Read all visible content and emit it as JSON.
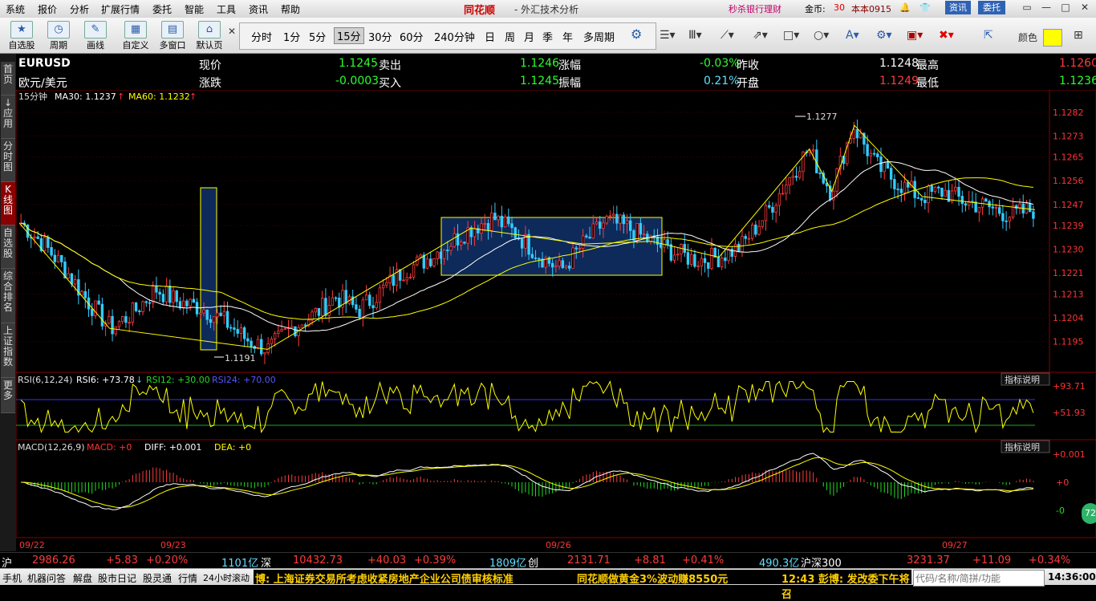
{
  "app": {
    "brand": "同花顺",
    "subtitle": "- 外汇技术分析"
  },
  "menu": [
    "系统",
    "报价",
    "分析",
    "扩展行情",
    "委托",
    "智能",
    "工具",
    "资讯",
    "帮助"
  ],
  "topright": {
    "promo": "秒杀银行理财",
    "coins_label": "金币:",
    "coins_value": "30",
    "user": "本本0915",
    "news_btn": "资讯",
    "trade_btn": "委托"
  },
  "toolbar": {
    "buttons": [
      "自选股",
      "周期",
      "画线",
      "自定义",
      "多窗口",
      "默认页"
    ],
    "periods": [
      "分时",
      "1分",
      "5分",
      "15分",
      "30分",
      "60分",
      "240分钟",
      "日",
      "周",
      "月",
      "季",
      "年",
      "多周期"
    ],
    "active_period": "15分",
    "color_label": "颜色",
    "highlight_color": "#ffff00"
  },
  "sidebar": [
    "首页",
    "应用",
    "分时图",
    "K线图",
    "自选股",
    "综合排名",
    "上证指数",
    "更多"
  ],
  "sidebar_active": "K线图",
  "quote": {
    "symbol": "EURUSD",
    "name": "欧元/美元",
    "fields": [
      {
        "label": "现价",
        "value": "1.1245",
        "color": "green"
      },
      {
        "label": "卖出",
        "value": "1.1246",
        "color": "green"
      },
      {
        "label": "涨幅",
        "value": "-0.03%",
        "color": "green"
      },
      {
        "label": "昨收",
        "value": "1.1248",
        "color": "white"
      },
      {
        "label": "最高",
        "value": "1.1260",
        "color": "red"
      },
      {
        "label": "涨跌",
        "value": "-0.0003",
        "color": "green"
      },
      {
        "label": "买入",
        "value": "1.1245",
        "color": "green"
      },
      {
        "label": "振幅",
        "value": "0.21%",
        "color": "cyan"
      },
      {
        "label": "开盘",
        "value": "1.1249",
        "color": "red"
      },
      {
        "label": "最低",
        "value": "1.1236",
        "color": "green"
      }
    ]
  },
  "kline": {
    "period_label": "15分钟",
    "ma30_label": "MA30: 1.1237",
    "ma60_label": "MA60: 1.1232",
    "yticks": [
      "1.1282",
      "1.1273",
      "1.1265",
      "1.1256",
      "1.1247",
      "1.1239",
      "1.1230",
      "1.1221",
      "1.1213",
      "1.1204",
      "1.1195"
    ],
    "high_label": "1.1277",
    "low_label": "1.1191"
  },
  "rsi": {
    "title": "RSI(6,12,24)",
    "rsi6": "RSI6: +73.78",
    "rsi12": "RSI12: +30.00",
    "rsi24": "RSI24: +70.00",
    "yticks": [
      "+93.71",
      "+51.93"
    ],
    "help": "指标说明"
  },
  "macd": {
    "title": "MACD(12,26,9)",
    "macd": "MACD: +0",
    "diff": "DIFF: +0.001",
    "dea": "DEA: +0",
    "yticks": [
      "+0.001",
      "+0",
      "-0"
    ],
    "help": "指标说明"
  },
  "dates": [
    "09/22",
    "09/23",
    "09/26",
    "09/27"
  ],
  "chart_data": {
    "type": "candlestick",
    "title": "EURUSD 15分钟",
    "ylim": [
      1.119,
      1.1285
    ],
    "notes": "approximate close path read from chart",
    "close_path": [
      1.124,
      1.1232,
      1.1222,
      1.121,
      1.12,
      1.1206,
      1.1215,
      1.121,
      1.1208,
      1.1203,
      1.1196,
      1.1192,
      1.12,
      1.1205,
      1.1212,
      1.1207,
      1.1214,
      1.1222,
      1.1226,
      1.1232,
      1.1238,
      1.1242,
      1.1236,
      1.1228,
      1.1222,
      1.1232,
      1.1241,
      1.1238,
      1.1233,
      1.1229,
      1.1226,
      1.1227,
      1.1231,
      1.1242,
      1.1255,
      1.1268,
      1.1252,
      1.1277,
      1.1262,
      1.1255,
      1.125,
      1.1252,
      1.1248,
      1.1246,
      1.1243,
      1.1245
    ]
  },
  "status": {
    "sh_label": "沪",
    "sh_index": "2986.26",
    "sh_chg": "+5.83",
    "sh_pct": "+0.20%",
    "sh_amt": "1101亿",
    "sz_label": "深",
    "sz_index": "10432.73",
    "sz_chg": "+40.03",
    "sz_pct": "+0.39%",
    "sz_amt": "1809亿",
    "cy_label": "创",
    "cy_index": "2131.71",
    "cy_chg": "+8.81",
    "cy_pct": "+0.41%",
    "cy_amt": "490.3亿",
    "hs_label": "沪深300",
    "hs_index": "3231.37",
    "hs_chg": "+11.09",
    "hs_pct": "+0.34%"
  },
  "bottom": {
    "items": [
      "手机",
      "机器问答",
      "解盘",
      "股市日记",
      "股灵通",
      "行情",
      "24小时滚动"
    ],
    "ticker1": "博: 上海证券交易所考虑收紧房地产企业公司债审核标准",
    "ticker2": "同花顺做黄金3%波动赚8550元",
    "ticker3": "12:43 彭博: 发改委下午将召",
    "code_placeholder": "代码/名称/简拼/功能",
    "time": "14:36:00",
    "bubble": "72"
  }
}
